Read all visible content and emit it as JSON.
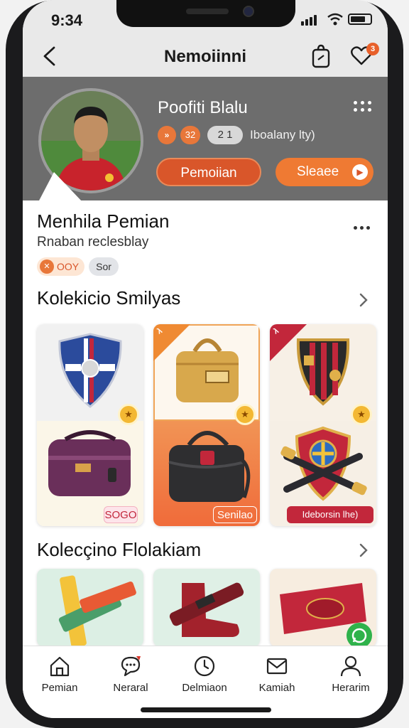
{
  "status_bar": {
    "time": "9:34"
  },
  "nav": {
    "title": "Nemoiinni",
    "cart_badge": "3"
  },
  "profile": {
    "name": "Poofiti Blalu",
    "stat_icon": "»",
    "stat_value_a": "32",
    "stat_value_b": "2 1",
    "stat_text": "Iboalany lty)",
    "primary_button": "Pemoiian",
    "secondary_button": "Sleaee"
  },
  "player": {
    "title": "Menhila Pemian",
    "subtitle": "Rnaban reclesblay",
    "tag_a": "OOY",
    "tag_b": "Sor"
  },
  "sections": {
    "collection_a_title": "Kolekicio Smilyas",
    "collection_b_title": "Kolecçino Flolakiam"
  },
  "cards_row1": [
    {
      "corner_label": "",
      "badge": "★",
      "pill": "SOGO",
      "icons": [
        "shield-crest-icon",
        "duffel-bag-icon"
      ]
    },
    {
      "corner_label": "λ",
      "badge": "★",
      "pill": "Senilao",
      "icons": [
        "satchel-bag-icon",
        "messenger-bag-icon"
      ]
    },
    {
      "corner_label": "λ",
      "badge": "★",
      "pill": "Ideborsin lhe)",
      "icons": [
        "club-crest-icon",
        "trophy-crest-icon"
      ]
    }
  ],
  "colors": {
    "accent": "#e8773a",
    "accent_dark": "#d9562a",
    "header_bg": "#6d6d6d",
    "badge_red": "#c2273b",
    "whatsapp_green": "#2fb24b"
  },
  "bottom_nav": [
    {
      "label": "Pemian",
      "icon": "home-icon"
    },
    {
      "label": "Neraral",
      "icon": "chat-bubble-icon"
    },
    {
      "label": "Delmiaon",
      "icon": "clock-icon"
    },
    {
      "label": "Kamiah",
      "icon": "mail-icon"
    },
    {
      "label": "Herarim",
      "icon": "person-icon"
    }
  ]
}
